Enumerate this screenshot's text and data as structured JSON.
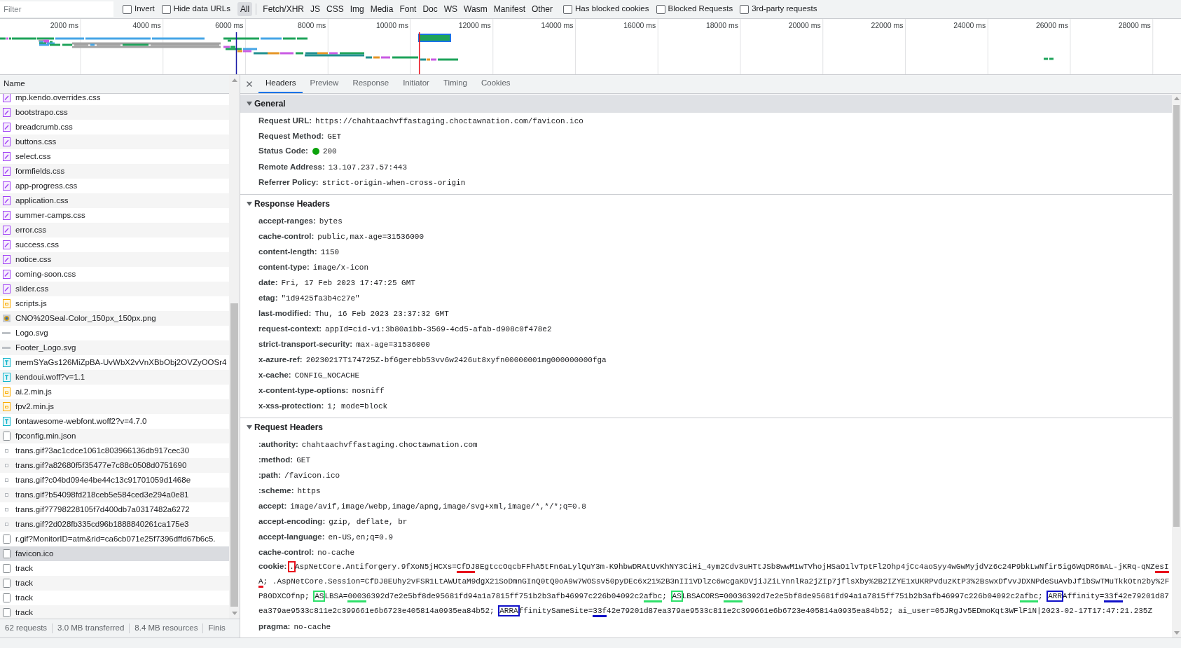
{
  "filter_bar": {
    "search": {
      "placeholder": "Filter"
    },
    "options": [
      {
        "label": "Invert",
        "checked": false
      },
      {
        "label": "Hide data URLs",
        "checked": false
      }
    ],
    "types": [
      {
        "label": "All",
        "selected": true
      },
      {
        "label": "Fetch/XHR",
        "selected": false
      },
      {
        "label": "JS",
        "selected": false
      },
      {
        "label": "CSS",
        "selected": false
      },
      {
        "label": "Img",
        "selected": false
      },
      {
        "label": "Media",
        "selected": false
      },
      {
        "label": "Font",
        "selected": false
      },
      {
        "label": "Doc",
        "selected": false
      },
      {
        "label": "WS",
        "selected": false
      },
      {
        "label": "Wasm",
        "selected": false
      },
      {
        "label": "Manifest",
        "selected": false
      },
      {
        "label": "Other",
        "selected": false
      }
    ],
    "flags": [
      {
        "label": "Has blocked cookies",
        "checked": false
      },
      {
        "label": "Blocked Requests",
        "checked": false
      },
      {
        "label": "3rd-party requests",
        "checked": false
      }
    ]
  },
  "timeline": {
    "ticks": [
      "2000 ms",
      "4000 ms",
      "6000 ms",
      "8000 ms",
      "10000 ms",
      "12000 ms",
      "14000 ms",
      "16000 ms",
      "18000 ms",
      "20000 ms",
      "22000 ms",
      "24000 ms",
      "26000 ms",
      "28000 ms"
    ]
  },
  "requests": {
    "column": "Name",
    "rows": [
      {
        "name": "mp.kendo.overrides.css",
        "kind": "stylesheet",
        "selected": false
      },
      {
        "name": "bootstrapo.css",
        "kind": "stylesheet",
        "selected": false
      },
      {
        "name": "breadcrumb.css",
        "kind": "stylesheet",
        "selected": false
      },
      {
        "name": "buttons.css",
        "kind": "stylesheet",
        "selected": false
      },
      {
        "name": "select.css",
        "kind": "stylesheet",
        "selected": false
      },
      {
        "name": "formfields.css",
        "kind": "stylesheet",
        "selected": false
      },
      {
        "name": "app-progress.css",
        "kind": "stylesheet",
        "selected": false
      },
      {
        "name": "application.css",
        "kind": "stylesheet",
        "selected": false
      },
      {
        "name": "summer-camps.css",
        "kind": "stylesheet",
        "selected": false
      },
      {
        "name": "error.css",
        "kind": "stylesheet",
        "selected": false
      },
      {
        "name": "success.css",
        "kind": "stylesheet",
        "selected": false
      },
      {
        "name": "notice.css",
        "kind": "stylesheet",
        "selected": false
      },
      {
        "name": "coming-soon.css",
        "kind": "stylesheet",
        "selected": false
      },
      {
        "name": "slider.css",
        "kind": "stylesheet",
        "selected": false
      },
      {
        "name": "scripts.js",
        "kind": "script",
        "selected": false
      },
      {
        "name": "CNO%20Seal-Color_150px_150px.png",
        "kind": "image",
        "selected": false
      },
      {
        "name": "Logo.svg",
        "kind": "vector",
        "selected": false
      },
      {
        "name": "Footer_Logo.svg",
        "kind": "vector",
        "selected": false
      },
      {
        "name": "memSYaGs126MiZpBA-UvWbX2vVnXBbObj2OVZyOOSr4",
        "kind": "font",
        "selected": false
      },
      {
        "name": "kendoui.woff?v=1.1",
        "kind": "font",
        "selected": false
      },
      {
        "name": "ai.2.min.js",
        "kind": "script",
        "selected": false
      },
      {
        "name": "fpv2.min.js",
        "kind": "script",
        "selected": false
      },
      {
        "name": "fontawesome-webfont.woff2?v=4.7.0",
        "kind": "font",
        "selected": false
      },
      {
        "name": "fpconfig.min.json",
        "kind": "document",
        "selected": false
      },
      {
        "name": "trans.gif?3ac1cdce1061c803966136db917cec30",
        "kind": "pixel",
        "selected": false
      },
      {
        "name": "trans.gif?a82680f5f35477e7c88c0508d0751690",
        "kind": "pixel",
        "selected": false
      },
      {
        "name": "trans.gif?c04bd094e4be44c13c91701059d1468e",
        "kind": "pixel",
        "selected": false
      },
      {
        "name": "trans.gif?b54098fd218ceb5e584ced3e294a0e81",
        "kind": "pixel",
        "selected": false
      },
      {
        "name": "trans.gif?7798228105f7d400db7a0317482a6272",
        "kind": "pixel",
        "selected": false
      },
      {
        "name": "trans.gif?2d028fb335cd96b1888840261ca175e3",
        "kind": "pixel",
        "selected": false
      },
      {
        "name": "r.gif?MonitorID=atm&rid=ca6cb071e25f7396dffd67b6c5.",
        "kind": "document",
        "selected": false
      },
      {
        "name": "favicon.ico",
        "kind": "document",
        "selected": true
      },
      {
        "name": "track",
        "kind": "document",
        "selected": false
      },
      {
        "name": "track",
        "kind": "document",
        "selected": false
      },
      {
        "name": "track",
        "kind": "document",
        "selected": false
      },
      {
        "name": "track",
        "kind": "document",
        "selected": false
      }
    ]
  },
  "status_bar": [
    "62 requests",
    "3.0 MB transferred",
    "8.4 MB resources",
    "Finis"
  ],
  "details": {
    "tabs": [
      {
        "label": "Headers",
        "selected": true
      },
      {
        "label": "Preview",
        "selected": false
      },
      {
        "label": "Response",
        "selected": false
      },
      {
        "label": "Initiator",
        "selected": false
      },
      {
        "label": "Timing",
        "selected": false
      },
      {
        "label": "Cookies",
        "selected": false
      }
    ],
    "sections": [
      {
        "title": "General",
        "expanded": true,
        "selected": true,
        "items": [
          {
            "name": "Request URL:",
            "value": "https://chahtaachvffastaging.choctawnation.com/favicon.ico",
            "kind": "text"
          },
          {
            "name": "Request Method:",
            "value": "GET",
            "kind": "text"
          },
          {
            "name": "Status Code:",
            "value": "200",
            "kind": "status"
          },
          {
            "name": "Remote Address:",
            "value": "13.107.237.57:443",
            "kind": "text"
          },
          {
            "name": "Referrer Policy:",
            "value": "strict-origin-when-cross-origin",
            "kind": "text"
          }
        ]
      },
      {
        "title": "Response Headers",
        "expanded": true,
        "selected": false,
        "items": [
          {
            "name": "accept-ranges:",
            "value": "bytes",
            "kind": "text"
          },
          {
            "name": "cache-control:",
            "value": "public,max-age=31536000",
            "kind": "text"
          },
          {
            "name": "content-length:",
            "value": "1150",
            "kind": "text"
          },
          {
            "name": "content-type:",
            "value": "image/x-icon",
            "kind": "text"
          },
          {
            "name": "date:",
            "value": "Fri, 17 Feb 2023 17:47:25 GMT",
            "kind": "text"
          },
          {
            "name": "etag:",
            "value": "\"1d9425fa3b4c27e\"",
            "kind": "text"
          },
          {
            "name": "last-modified:",
            "value": "Thu, 16 Feb 2023 23:37:32 GMT",
            "kind": "text"
          },
          {
            "name": "request-context:",
            "value": "appId=cid-v1:3b80a1bb-3569-4cd5-afab-d908c0f478e2",
            "kind": "text"
          },
          {
            "name": "strict-transport-security:",
            "value": "max-age=31536000",
            "kind": "text"
          },
          {
            "name": "x-azure-ref:",
            "value": "20230217T174725Z-bf6gerebb53vv6w2426ut8xyfn00000001mg000000000fga",
            "kind": "text"
          },
          {
            "name": "x-cache:",
            "value": "CONFIG_NOCACHE",
            "kind": "text"
          },
          {
            "name": "x-content-type-options:",
            "value": "nosniff",
            "kind": "text"
          },
          {
            "name": "x-xss-protection:",
            "value": "1; mode=block",
            "kind": "text"
          }
        ]
      },
      {
        "title": "Request Headers",
        "expanded": true,
        "selected": false,
        "items": [
          {
            "name": ":authority:",
            "value": "chahtaachvffastaging.choctawnation.com",
            "kind": "text"
          },
          {
            "name": ":method:",
            "value": "GET",
            "kind": "text"
          },
          {
            "name": ":path:",
            "value": "/favicon.ico",
            "kind": "text"
          },
          {
            "name": ":scheme:",
            "value": "https",
            "kind": "text"
          },
          {
            "name": "accept:",
            "value": "image/avif,image/webp,image/apng,image/svg+xml,image/*,*/*;q=0.8",
            "kind": "text"
          },
          {
            "name": "accept-encoding:",
            "value": "gzip, deflate, br",
            "kind": "text"
          },
          {
            "name": "accept-language:",
            "value": "en-US,en;q=0.9",
            "kind": "text"
          },
          {
            "name": "cache-control:",
            "value": "no-cache",
            "kind": "text"
          },
          {
            "name": "cookie:",
            "kind": "annotated",
            "segments": [
              {
                "text": ".",
                "kind": "box",
                "color": "#e8101c"
              },
              {
                "text": "AspNetCore.Antiforgery.9fXoN5jHCXs=",
                "kind": "plain"
              },
              {
                "text": "CfDJ",
                "kind": "underline",
                "color": "#e8101c"
              },
              {
                "text": "8EgtccOqcbFFhA5tFn6aLylQuY3m-K9hbwDRAtUvKhNY3CiHi_4ym2Cdv3uHTtJSb8wwM1wTVhojHSaO1lvTptFl2Ohp4jCc4aoSyy4wGwMyjdVz6c24P9bkLwNfir5ig6WqDR6mAL-jKRq-qNZ",
                "kind": "plain"
              },
              {
                "text": "esI",
                "kind": "underline",
                "color": "#e8101c"
              },
              {
                "text": "A",
                "kind": "underline",
                "color": "#e8101c"
              },
              {
                "text": "; .AspNetCore.Session=CfDJ8EUhy2vFSR1LtAWUtaM9dgX21SoDmnGInQ0tQ0oA9w7WOSsv50pyDEc6x21%2B3nII1VDlzc6wcgaKDVjiJZiLYnnlRa2jZIp7jflsXby%2B2IZYE1xUKRPvduzKtP3%2BswxDfvvJDXNPdeSuAvbJfibSwTMuTkkOtn2by%2FP80DXCOfnp; ",
                "kind": "plain"
              },
              {
                "text": "AS",
                "kind": "box",
                "color": "#2ee06a"
              },
              {
                "text": "LBSA=",
                "kind": "plain"
              },
              {
                "text": "0003",
                "kind": "underline",
                "color": "#2ee06a"
              },
              {
                "text": "6392d7e2e5bf8de95681fd94a1a7815ff751b2b3afb46997c226b04092c2",
                "kind": "plain"
              },
              {
                "text": "afbc",
                "kind": "underline",
                "color": "#2ee06a"
              },
              {
                "text": "; ",
                "kind": "plain"
              },
              {
                "text": "AS",
                "kind": "box",
                "color": "#2ee06a"
              },
              {
                "text": "LBSACORS=",
                "kind": "plain"
              },
              {
                "text": "0003",
                "kind": "underline",
                "color": "#2ee06a"
              },
              {
                "text": "6392d7e2e5bf8de95681fd94a1a7815ff751b2b3afb46997c226b04092c2",
                "kind": "plain"
              },
              {
                "text": "afbc",
                "kind": "underline",
                "color": "#2ee06a"
              },
              {
                "text": "; ",
                "kind": "plain"
              },
              {
                "text": "ARR",
                "kind": "box",
                "color": "#1010c8"
              },
              {
                "text": "Affinity=",
                "kind": "plain"
              },
              {
                "text": "33f4",
                "kind": "underline",
                "color": "#1010c8"
              },
              {
                "text": "2e79201d87ea379ae9533c811e2c399661e6b6723e405814a0935ea84b52; ",
                "kind": "plain"
              },
              {
                "text": "ARRA",
                "kind": "box",
                "color": "#1010c8"
              },
              {
                "text": "ffinitySameSite=",
                "kind": "plain"
              },
              {
                "text": "33f",
                "kind": "underline",
                "color": "#1010c8"
              },
              {
                "text": "42e79201d87ea379ae9533c811e2c399661e6b6723e405814a0935ea84b52; ai_user=05JRgJv5EDmoKqt3WFlF1N|2023-02-17T17:47:21.235Z",
                "kind": "plain"
              }
            ]
          },
          {
            "name": "pragma:",
            "value": "no-cache",
            "kind": "text"
          }
        ]
      }
    ]
  }
}
